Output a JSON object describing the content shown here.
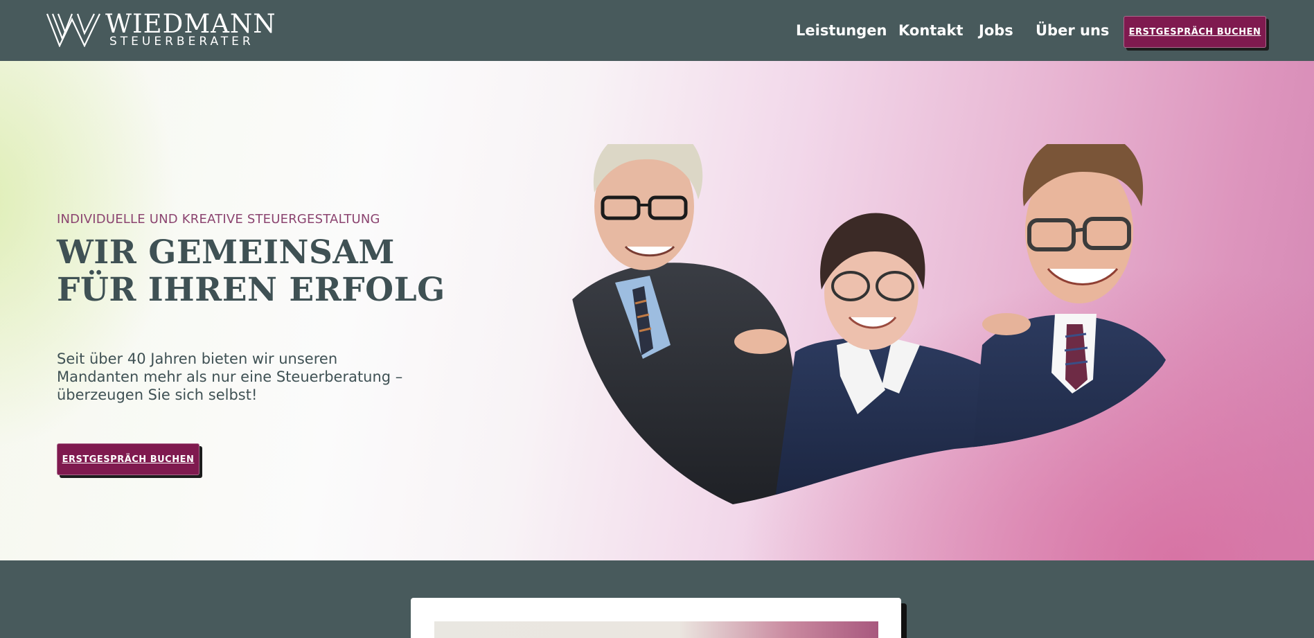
{
  "header": {
    "logo": {
      "name": "WIEDMANN",
      "subtitle": "STEUERBERATER"
    },
    "nav": [
      {
        "label": "Leistungen"
      },
      {
        "label": "Kontakt"
      },
      {
        "label": "Jobs"
      },
      {
        "label": "Über uns"
      }
    ],
    "cta_label": "ERSTGESPRÄCH BUCHEN"
  },
  "hero": {
    "eyebrow": "INDIVIDUELLE UND KREATIVE STEUERGESTALTUNG",
    "headline_line1": "WIR GEMEINSAM",
    "headline_line2": "FÜR IHREN ERFOLG",
    "lead": "Seit über 40 Jahren bieten wir unseren Mandanten mehr als nur eine Steuerberatung – überzeugen Sie sich selbst!",
    "cta_label": "ERSTGESPRÄCH BUCHEN"
  },
  "colors": {
    "header_bg": "#485a5c",
    "accent": "#7f1a4f",
    "text": "#3f5154",
    "eyebrow": "#8b4470"
  },
  "icons": {
    "logo_mark": "double-w-logo-icon"
  }
}
